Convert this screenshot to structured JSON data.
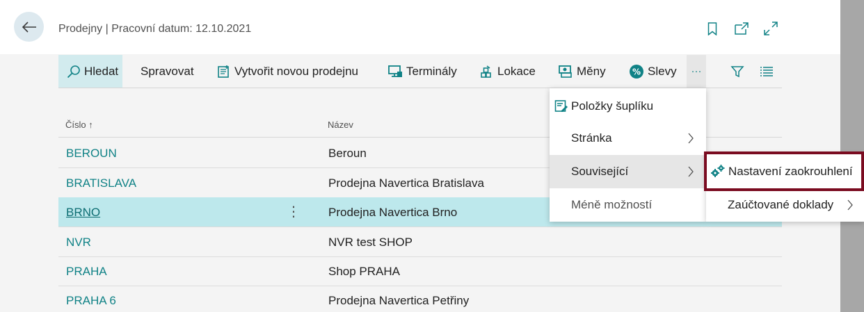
{
  "header": {
    "title": "Prodejny | Pracovní datum: 12.10.2021"
  },
  "toolbar": {
    "search": "Hledat",
    "manage": "Spravovat",
    "new_store": "Vytvořit novou prodejnu",
    "terminals": "Terminály",
    "locations": "Lokace",
    "currencies": "Měny",
    "discounts": "Slevy",
    "more": "···"
  },
  "grid": {
    "col_code": "Číslo ↑",
    "col_name": "Název",
    "rows": [
      {
        "code": "BEROUN",
        "name": "Beroun"
      },
      {
        "code": "BRATISLAVA",
        "name": "Prodejna Navertica Bratislava"
      },
      {
        "code": "BRNO",
        "name": "Prodejna Navertica Brno"
      },
      {
        "code": "NVR",
        "name": "NVR test SHOP"
      },
      {
        "code": "PRAHA",
        "name": "Shop PRAHA"
      },
      {
        "code": "PRAHA 6",
        "name": "Prodejna Navertica Petřiny"
      }
    ],
    "row_menu": "⋮"
  },
  "menu": {
    "drawer_items": "Položky šuplíku",
    "page": "Stránka",
    "related": "Související",
    "fewer": "Méně možností"
  },
  "submenu": {
    "rounding_setup": "Nastavení zaokrouhlení",
    "posted_docs": "Zaúčtované doklady"
  },
  "colors": {
    "accent": "#108286",
    "selected_row": "#bde8ec",
    "highlight_box": "#7a0b20"
  }
}
